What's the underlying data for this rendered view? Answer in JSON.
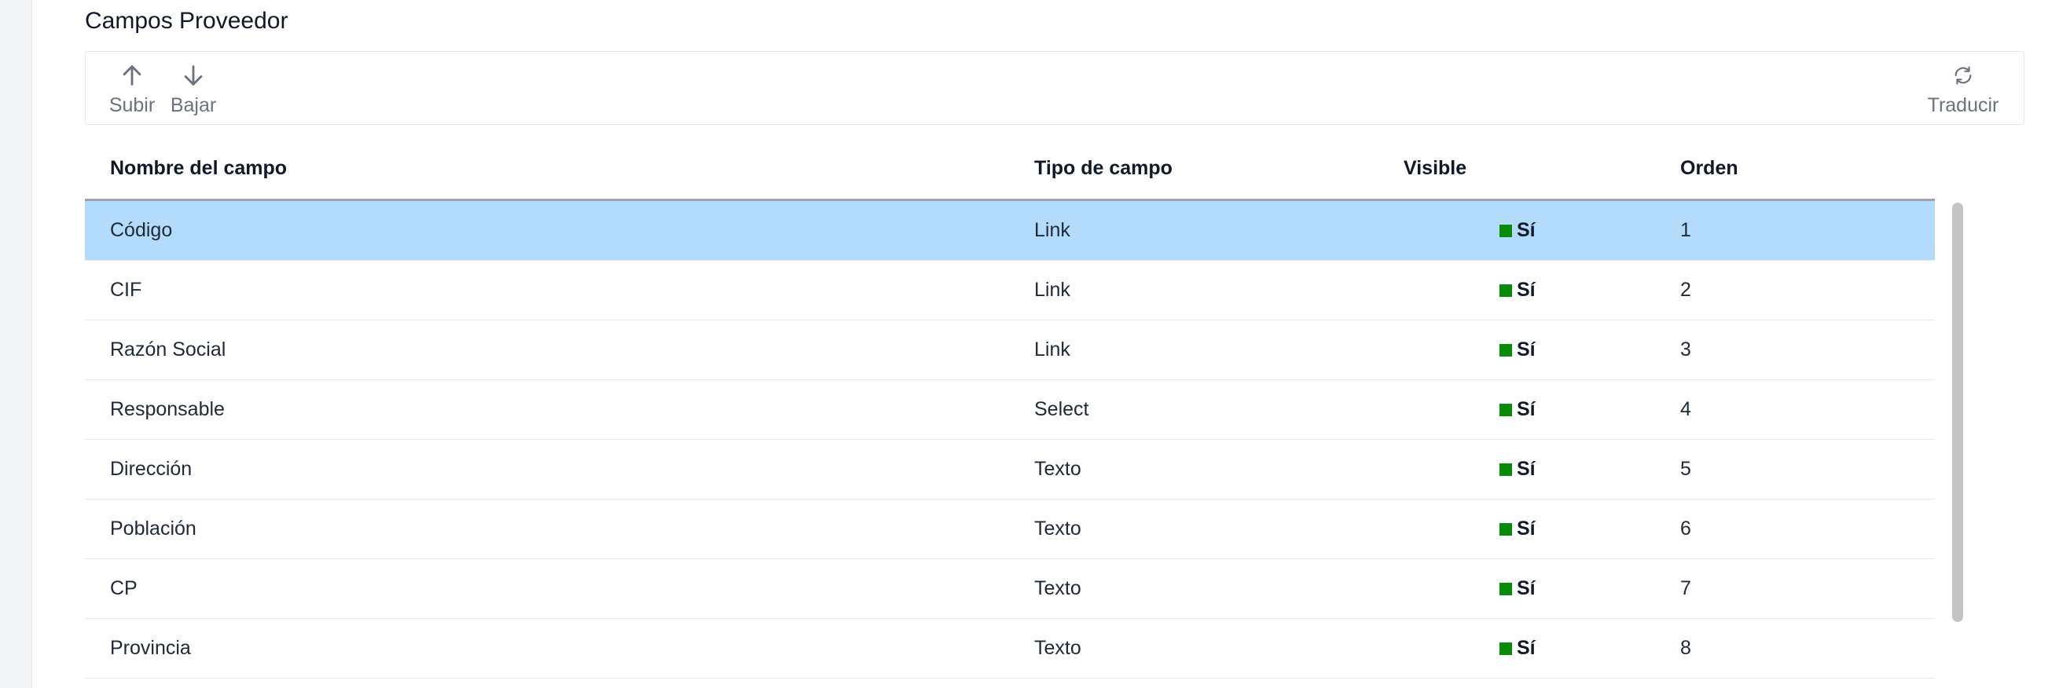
{
  "page": {
    "title": "Campos Proveedor"
  },
  "toolbar": {
    "up_label": "Subir",
    "down_label": "Bajar",
    "translate_label": "Traducir",
    "icons": {
      "up": "arrow-up-icon",
      "down": "arrow-down-icon",
      "translate": "refresh-icon"
    }
  },
  "table": {
    "columns": [
      "Nombre del campo",
      "Tipo de campo",
      "Visible",
      "Orden"
    ],
    "rows": [
      {
        "name": "Código",
        "type": "Link",
        "visible": "Sí",
        "order": "1",
        "selected": true
      },
      {
        "name": "CIF",
        "type": "Link",
        "visible": "Sí",
        "order": "2",
        "selected": false
      },
      {
        "name": "Razón Social",
        "type": "Link",
        "visible": "Sí",
        "order": "3",
        "selected": false
      },
      {
        "name": "Responsable",
        "type": "Select",
        "visible": "Sí",
        "order": "4",
        "selected": false
      },
      {
        "name": "Dirección",
        "type": "Texto",
        "visible": "Sí",
        "order": "5",
        "selected": false
      },
      {
        "name": "Población",
        "type": "Texto",
        "visible": "Sí",
        "order": "6",
        "selected": false
      },
      {
        "name": "CP",
        "type": "Texto",
        "visible": "Sí",
        "order": "7",
        "selected": false
      },
      {
        "name": "Provincia",
        "type": "Texto",
        "visible": "Sí",
        "order": "8",
        "selected": false
      }
    ]
  },
  "colors": {
    "selected_row": "#b3dcfc",
    "visible_indicator": "#0a8a0a"
  }
}
